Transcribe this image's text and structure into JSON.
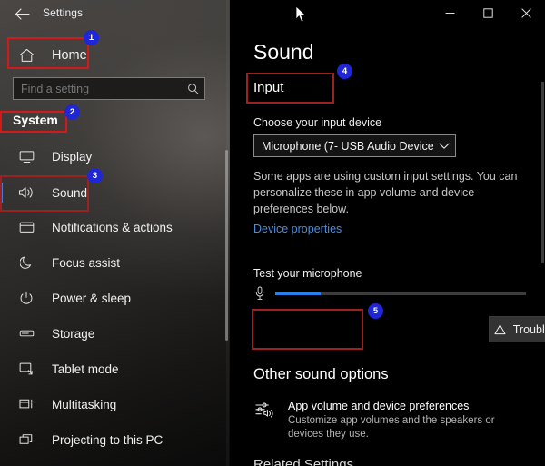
{
  "window": {
    "app_title": "Settings",
    "back_icon": "back-arrow-icon",
    "controls": {
      "minimize": "—",
      "maximize": "□",
      "close": "✕"
    }
  },
  "sidebar": {
    "home": {
      "label": "Home",
      "icon": "home-icon"
    },
    "search": {
      "placeholder": "Find a setting",
      "value": "",
      "icon": "search-icon"
    },
    "section_header": "System",
    "items": [
      {
        "label": "Display",
        "icon": "monitor-icon",
        "selected": false
      },
      {
        "label": "Sound",
        "icon": "speaker-icon",
        "selected": true
      },
      {
        "label": "Notifications & actions",
        "icon": "notification-icon",
        "selected": false
      },
      {
        "label": "Focus assist",
        "icon": "moon-icon",
        "selected": false
      },
      {
        "label": "Power & sleep",
        "icon": "power-icon",
        "selected": false
      },
      {
        "label": "Storage",
        "icon": "storage-icon",
        "selected": false
      },
      {
        "label": "Tablet mode",
        "icon": "tablet-icon",
        "selected": false
      },
      {
        "label": "Multitasking",
        "icon": "multitasking-icon",
        "selected": false
      },
      {
        "label": "Projecting to this PC",
        "icon": "projecting-icon",
        "selected": false
      }
    ]
  },
  "main": {
    "page_title": "Sound",
    "input_section": {
      "heading": "Input",
      "choose_label": "Choose your input device",
      "device_value": "Microphone (7- USB Audio Device)",
      "chevron_icon": "chevron-down-icon",
      "note": "Some apps are using custom input settings. You can personalize these in app volume and device preferences below.",
      "device_properties_link": "Device properties",
      "test_label": "Test your microphone",
      "mic_icon": "microphone-icon",
      "mic_level_percent": 18,
      "troubleshoot_label": "Troubleshoot",
      "troubleshoot_icon": "warning-triangle-icon"
    },
    "other_sound_options": {
      "heading": "Other sound options",
      "app_volume": {
        "icon": "sliders-speaker-icon",
        "title": "App volume and device preferences",
        "description": "Customize app volumes and the speakers or devices they use."
      },
      "related_settings_clipped": "Related Settings"
    }
  },
  "annotations": {
    "badges": [
      {
        "number": "1",
        "target": "Home"
      },
      {
        "number": "2",
        "target": "System"
      },
      {
        "number": "3",
        "target": "Sound"
      },
      {
        "number": "4",
        "target": "Input"
      },
      {
        "number": "5",
        "target": "Troubleshoot"
      }
    ],
    "highlight_color": "#d11a1a",
    "badge_color": "#1e26d6"
  },
  "colors": {
    "accent_blue": "#2a7fe8",
    "link_blue": "#4a8ee0",
    "selected_bar": "#3e7fd8",
    "panel_bg": "#000000"
  }
}
